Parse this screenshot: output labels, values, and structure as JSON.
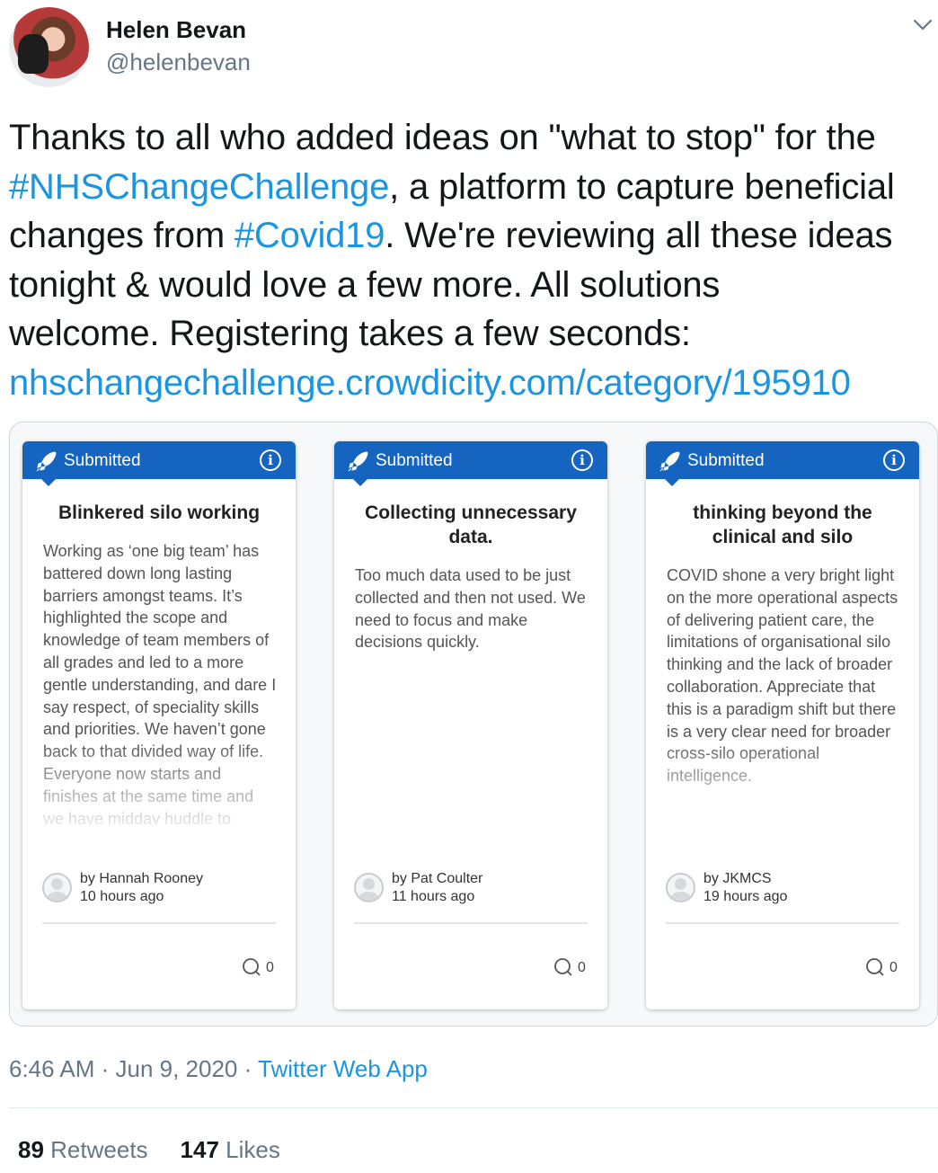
{
  "header": {
    "name": "Helen Bevan",
    "handle": "@helenbevan",
    "avatar_icon": "profile-photo",
    "menu_icon": "chevron-down-icon"
  },
  "tweet": {
    "lines": [
      [
        {
          "t": "Thanks to all who added ideas on \"what to stop\" for the",
          "link": false
        }
      ],
      [
        {
          "t": "#NHSChangeChallenge",
          "link": true
        },
        {
          "t": ", a platform to capture beneficial",
          "link": false
        }
      ],
      [
        {
          "t": "changes from ",
          "link": false
        },
        {
          "t": "#Covid19",
          "link": true
        },
        {
          "t": ". We're reviewing all these ideas",
          "link": false
        }
      ],
      [
        {
          "t": "tonight & would love a few more. All solutions",
          "link": false
        }
      ],
      [
        {
          "t": "welcome. Registering takes a few seconds:",
          "link": false
        }
      ],
      [
        {
          "t": "nhschangechallenge.crowdicity.com/category/195910",
          "link": true
        }
      ]
    ],
    "link_color": "#1b95e0"
  },
  "ideas": [
    {
      "status": "Submitted",
      "title": "Blinkered silo working",
      "body": "Working as ‘one big team’ has battered down long lasting barriers amongst teams. It’s highlighted the scope and knowledge of team members of all grades and led to a more gentle understanding, and dare I say respect, of speciality skills and priorities. We haven’t gone back to that divided way of life. Everyone now starts and finishes at the same time and we have midday huddle to",
      "author": "by Hannah Rooney",
      "time": "10 hours ago",
      "comments": "0"
    },
    {
      "status": "Submitted",
      "title": "Collecting unnecessary data.",
      "body": "Too much data used to be just collected and then not used. We need to focus and make decisions quickly.",
      "author": "by Pat Coulter",
      "time": "11 hours ago",
      "comments": "0"
    },
    {
      "status": "Submitted",
      "title": "thinking beyond the clinical and silo",
      "body": "COVID shone a very bright light on the more operational aspects of delivering patient care, the limitations of organisational silo thinking and the lack of broader collaboration. Appreciate that this is a paradigm shift but there is a very clear need for broader cross-silo operational intelligence.",
      "author": "by JKMCS",
      "time": "19 hours ago",
      "comments": "0"
    }
  ],
  "meta": {
    "time": "6:46 AM · Jun 9, 2020 · ",
    "source": "Twitter Web App"
  },
  "stats": {
    "retweets_count": "89",
    "retweets_label": "Retweets",
    "likes_count": "147",
    "likes_label": "Likes"
  },
  "colors": {
    "status_blue": "#1565c0",
    "text_gray": "#657786"
  }
}
